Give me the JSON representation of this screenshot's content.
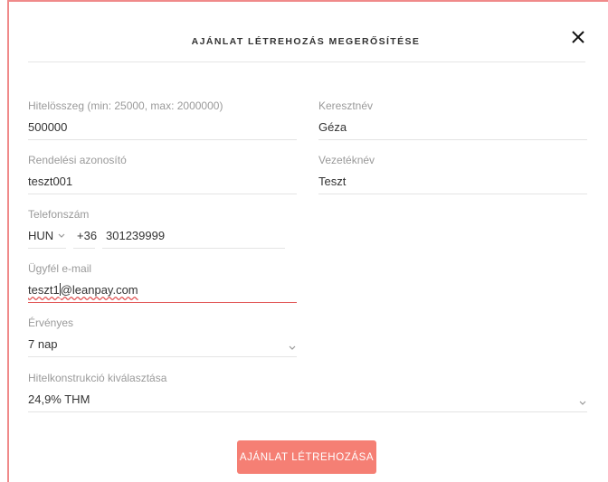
{
  "modal": {
    "title": "AJÁNLAT LÉTREHOZÁS MEGERŐSÍTÉSE",
    "submit_label": "AJÁNLAT LÉTREHOZÁSA"
  },
  "fields": {
    "loan_amount": {
      "label": "Hitelösszeg (min: 25000, max: 2000000)",
      "value": "500000"
    },
    "first_name": {
      "label": "Keresztnév",
      "value": "Géza"
    },
    "order_id": {
      "label": "Rendelési azonosító",
      "value": "teszt001"
    },
    "last_name": {
      "label": "Vezetéknév",
      "value": "Teszt"
    },
    "phone": {
      "label": "Telefonszám",
      "country": "HUN",
      "prefix": "+36",
      "number": "301239999"
    },
    "email": {
      "label": "Ügyfél e-mail",
      "value_part1": "teszt1",
      "value_part2": "@leanpay.com"
    },
    "validity": {
      "label": "Érvényes",
      "value": "7 nap"
    },
    "loan_construction": {
      "label": "Hitelkonstrukció kiválasztása",
      "value": "24,9% THM"
    }
  },
  "colors": {
    "accent": "#f57f74",
    "error_underline": "#e25a5a",
    "modal_border": "#f08a8a"
  }
}
